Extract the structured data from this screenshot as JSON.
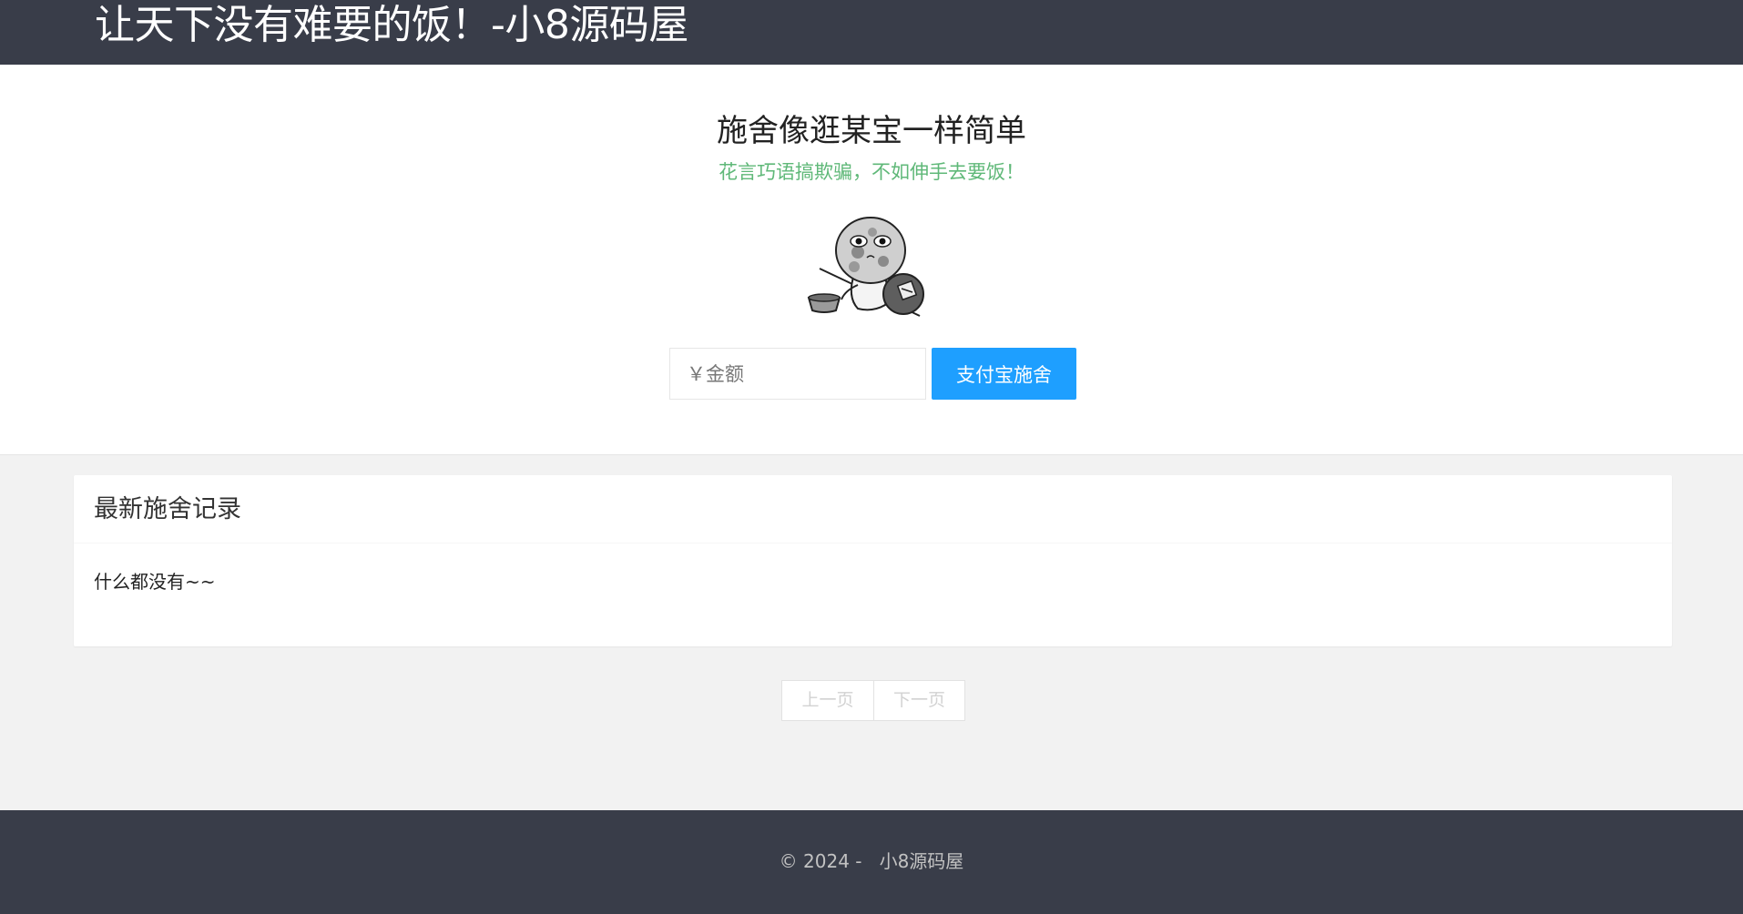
{
  "header": {
    "title": "让天下没有难要的饭！-小8源码屋"
  },
  "hero": {
    "title": "施舍像逛某宝一样简单",
    "subtitle": "花言巧语搞欺骗，不如伸手去要饭！",
    "image": "beggar-illustration",
    "amount_placeholder": "￥金额",
    "amount_value": "",
    "pay_button": "支付宝施舍"
  },
  "records": {
    "title": "最新施舍记录",
    "empty_text": "什么都没有~~"
  },
  "pagination": {
    "prev_label": "上一页",
    "next_label": "下一页"
  },
  "footer": {
    "copyright": "© 2024 -   小8源码屋"
  },
  "colors": {
    "header_bg": "#393d49",
    "accent_blue": "#1e9fff",
    "subtitle_green": "#5fb878",
    "page_bg": "#f2f2f2"
  }
}
